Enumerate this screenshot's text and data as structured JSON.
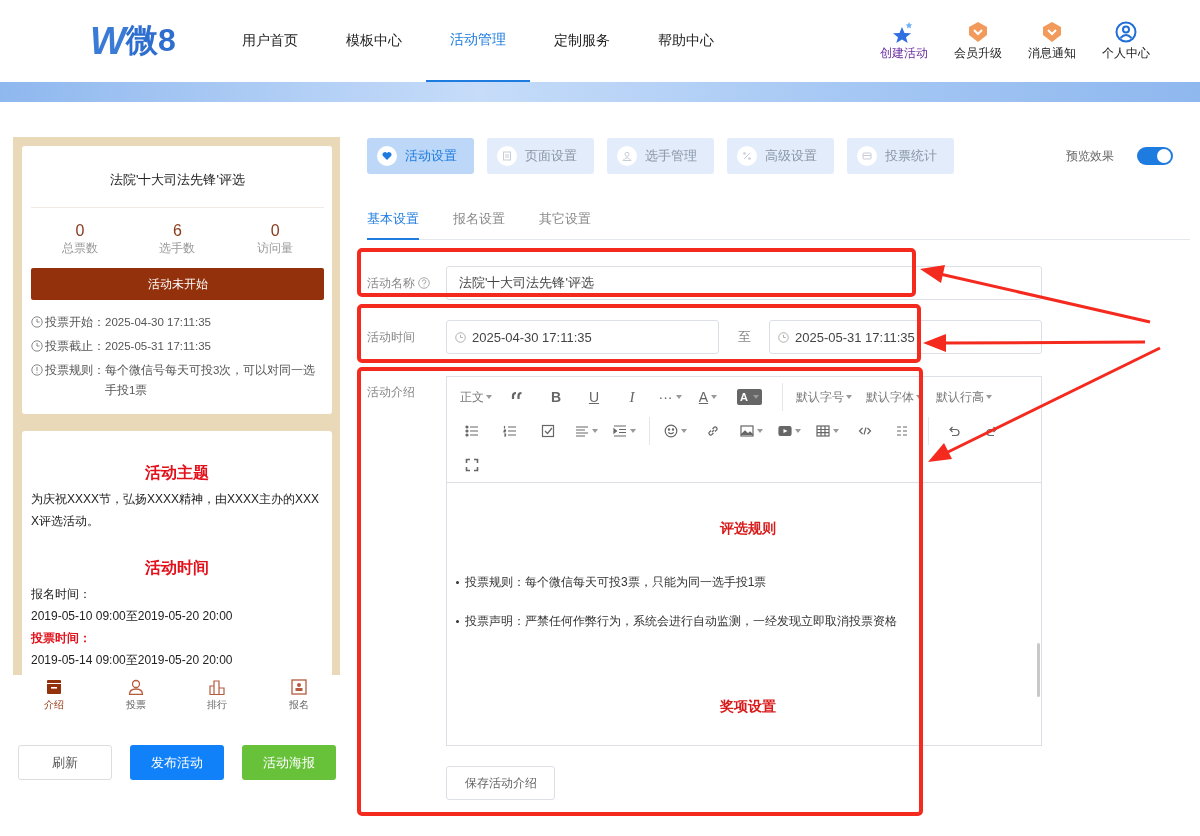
{
  "header": {
    "logo": {
      "mark": "W",
      "text": "微8"
    },
    "nav": [
      {
        "label": "用户首页",
        "selected": false
      },
      {
        "label": "模板中心",
        "selected": false
      },
      {
        "label": "活动管理",
        "selected": true
      },
      {
        "label": "定制服务",
        "selected": false
      },
      {
        "label": "帮助中心",
        "selected": false
      }
    ],
    "actions": [
      {
        "label": "创建活动",
        "kind": "stars"
      },
      {
        "label": "会员升级",
        "kind": "badge"
      },
      {
        "label": "消息通知",
        "kind": "badge"
      },
      {
        "label": "个人中心",
        "kind": "user"
      }
    ]
  },
  "preview": {
    "title": "法院'十大司法先锋'评选",
    "stats": [
      {
        "value": "0",
        "label": "总票数"
      },
      {
        "value": "6",
        "label": "选手数"
      },
      {
        "value": "0",
        "label": "访问量"
      }
    ],
    "status_button": "活动未开始",
    "info": [
      {
        "kind": "clock",
        "label": "投票开始：",
        "value": "2025-04-30 17:11:35"
      },
      {
        "kind": "clock",
        "label": "投票截止：",
        "value": "2025-05-31 17:11:35"
      },
      {
        "kind": "info",
        "label": "投票规则：",
        "value": "每个微信号每天可投3次，可以对同一选手投1票"
      }
    ],
    "content": [
      {
        "kind": "heading",
        "text": "活动主题"
      },
      {
        "kind": "para",
        "text": "为庆祝XXXX节，弘扬XXXX精神，由XXXX主办的XXXX评选活动。"
      },
      {
        "kind": "heading",
        "text": "活动时间"
      },
      {
        "kind": "para",
        "text": "报名时间："
      },
      {
        "kind": "para",
        "text": "2019-05-10 09:00至2019-05-20 20:00"
      },
      {
        "kind": "highlight",
        "text": "投票时间："
      },
      {
        "kind": "para",
        "text": "2019-05-14 09:00至2019-05-20 20:00"
      }
    ],
    "bottom_nav": [
      {
        "label": "介绍",
        "kind": "book",
        "selected": true
      },
      {
        "label": "投票",
        "kind": "person",
        "selected": false
      },
      {
        "label": "排行",
        "kind": "chart",
        "selected": false
      },
      {
        "label": "报名",
        "kind": "badge",
        "selected": false
      }
    ],
    "buttons": [
      {
        "label": "刷新",
        "kind": "plain"
      },
      {
        "label": "发布活动",
        "kind": "primary"
      },
      {
        "label": "活动海报",
        "kind": "success"
      }
    ]
  },
  "settings": {
    "tabs": [
      {
        "label": "活动设置",
        "kind": "heart",
        "selected": true
      },
      {
        "label": "页面设置",
        "kind": "page",
        "selected": false
      },
      {
        "label": "选手管理",
        "kind": "person",
        "selected": false
      },
      {
        "label": "高级设置",
        "kind": "percent",
        "selected": false
      },
      {
        "label": "投票统计",
        "kind": "card",
        "selected": false
      }
    ],
    "preview_toggle": {
      "label": "预览效果",
      "on": true
    },
    "subtabs": [
      {
        "label": "基本设置",
        "selected": true
      },
      {
        "label": "报名设置",
        "selected": false
      },
      {
        "label": "其它设置",
        "selected": false
      }
    ],
    "name_field": {
      "label": "活动名称",
      "value": "法院'十大司法先锋'评选"
    },
    "time_field": {
      "label": "活动时间",
      "start": "2025-04-30 17:11:35",
      "separator": "至",
      "end": "2025-05-31 17:11:35"
    },
    "intro": {
      "label": "活动介绍",
      "toolbar": [
        [
          {
            "kind": "menu",
            "text": "正文"
          },
          {
            "kind": "quote"
          },
          {
            "kind": "bold",
            "text": "B"
          },
          {
            "kind": "underline",
            "text": "U"
          },
          {
            "kind": "italic",
            "text": "I"
          },
          {
            "kind": "more",
            "text": "···"
          },
          {
            "kind": "fontcolor",
            "text": "A"
          },
          {
            "kind": "highlight",
            "text": "A"
          },
          {
            "kind": "sep"
          },
          {
            "kind": "menu",
            "text": "默认字号"
          },
          {
            "kind": "menu",
            "text": "默认字体"
          },
          {
            "kind": "menu",
            "text": "默认行高"
          }
        ],
        [
          {
            "kind": "bullets"
          },
          {
            "kind": "numbers"
          },
          {
            "kind": "todo"
          },
          {
            "kind": "align"
          },
          {
            "kind": "indent"
          },
          {
            "kind": "sep"
          },
          {
            "kind": "emoji"
          },
          {
            "kind": "link"
          },
          {
            "kind": "image"
          },
          {
            "kind": "video"
          },
          {
            "kind": "table"
          },
          {
            "kind": "code"
          },
          {
            "kind": "divider"
          },
          {
            "kind": "sep"
          },
          {
            "kind": "undo"
          },
          {
            "kind": "redo"
          }
        ],
        [
          {
            "kind": "fullscreen"
          }
        ]
      ],
      "content": [
        {
          "kind": "heading",
          "text": "评选规则"
        },
        {
          "kind": "bullet",
          "text": "投票规则：每个微信每天可投3票，只能为同一选手投1票"
        },
        {
          "kind": "bullet",
          "text": "投票声明：严禁任何作弊行为，系统会进行自动监测，一经发现立即取消投票资格"
        },
        {
          "kind": "heading",
          "text": "奖项设置"
        }
      ],
      "save_button": "保存活动介绍"
    }
  }
}
